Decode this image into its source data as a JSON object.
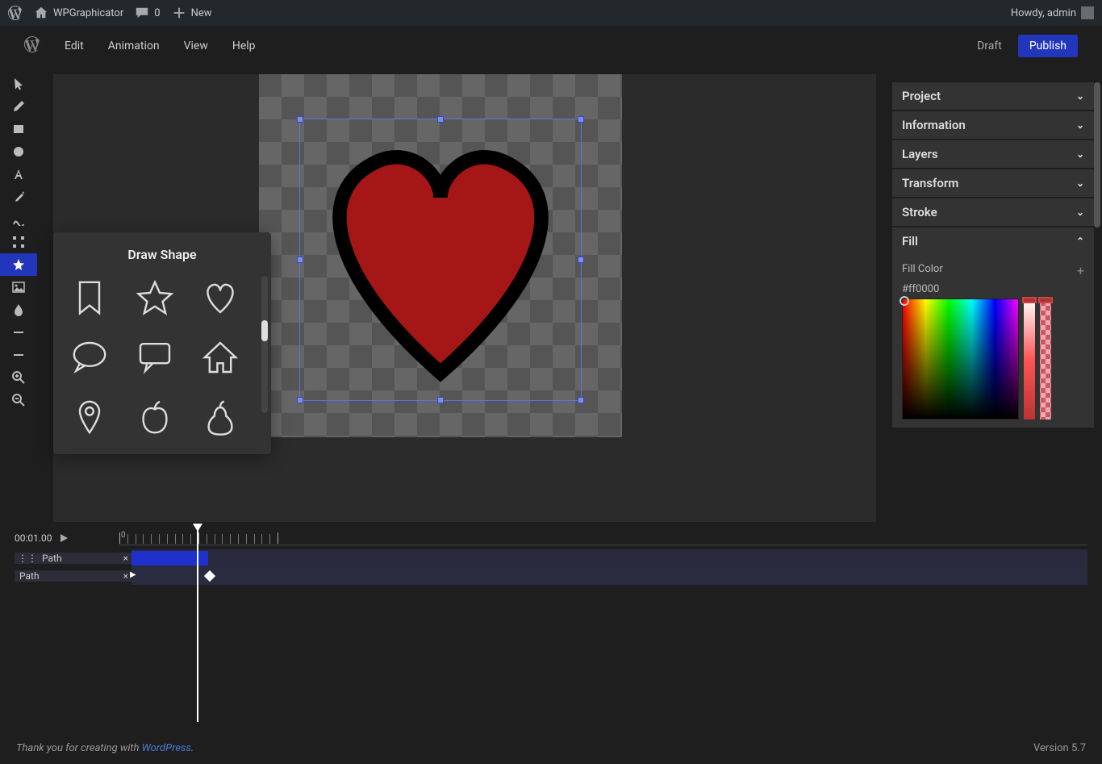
{
  "wp_bar": {
    "site_name": "WPGraphicator",
    "comments_count": "0",
    "new_label": "New",
    "greeting": "Howdy, admin"
  },
  "top_menu": {
    "items": [
      "Edit",
      "Animation",
      "View",
      "Help"
    ],
    "draft": "Draft",
    "publish": "Publish"
  },
  "tools": [
    {
      "name": "select-tool",
      "icon": "cursor"
    },
    {
      "name": "pencil-tool",
      "icon": "pencil"
    },
    {
      "name": "rect-tool",
      "icon": "rect"
    },
    {
      "name": "circle-tool",
      "icon": "circle"
    },
    {
      "name": "text-tool",
      "icon": "text"
    },
    {
      "name": "eyedropper-tool",
      "icon": "eyedropper"
    },
    {
      "name": "path-tool",
      "icon": "path"
    },
    {
      "name": "transform-tool",
      "icon": "transform"
    },
    {
      "name": "shape-tool",
      "icon": "star",
      "active": true
    },
    {
      "name": "image-tool",
      "icon": "image"
    },
    {
      "name": "blur-tool",
      "icon": "drop"
    },
    {
      "name": "crop-tool",
      "icon": "minus"
    },
    {
      "name": "remove-tool",
      "icon": "minus2"
    },
    {
      "name": "zoom-in-tool",
      "icon": "zoomin"
    },
    {
      "name": "zoom-out-tool",
      "icon": "zoomout"
    }
  ],
  "shape_popup": {
    "title": "Draw Shape",
    "shapes": [
      "bookmark",
      "star",
      "heart",
      "speech-bubble",
      "chat-rect",
      "house",
      "pin",
      "apple",
      "pear"
    ]
  },
  "right_panel": {
    "sections": [
      "Project",
      "Information",
      "Layers",
      "Transform",
      "Stroke"
    ],
    "fill": {
      "title": "Fill",
      "label": "Fill Color",
      "value": "#ff0000"
    }
  },
  "timeline": {
    "current_time": "00:01.00",
    "ruler_zero": "0",
    "tracks": [
      {
        "label": "Path",
        "type": "group"
      },
      {
        "label": "Path",
        "type": "prop"
      }
    ]
  },
  "footer": {
    "thanks_prefix": "Thank you for creating with ",
    "wordpress": "WordPress",
    "thanks_suffix": ".",
    "version": "Version 5.7"
  }
}
